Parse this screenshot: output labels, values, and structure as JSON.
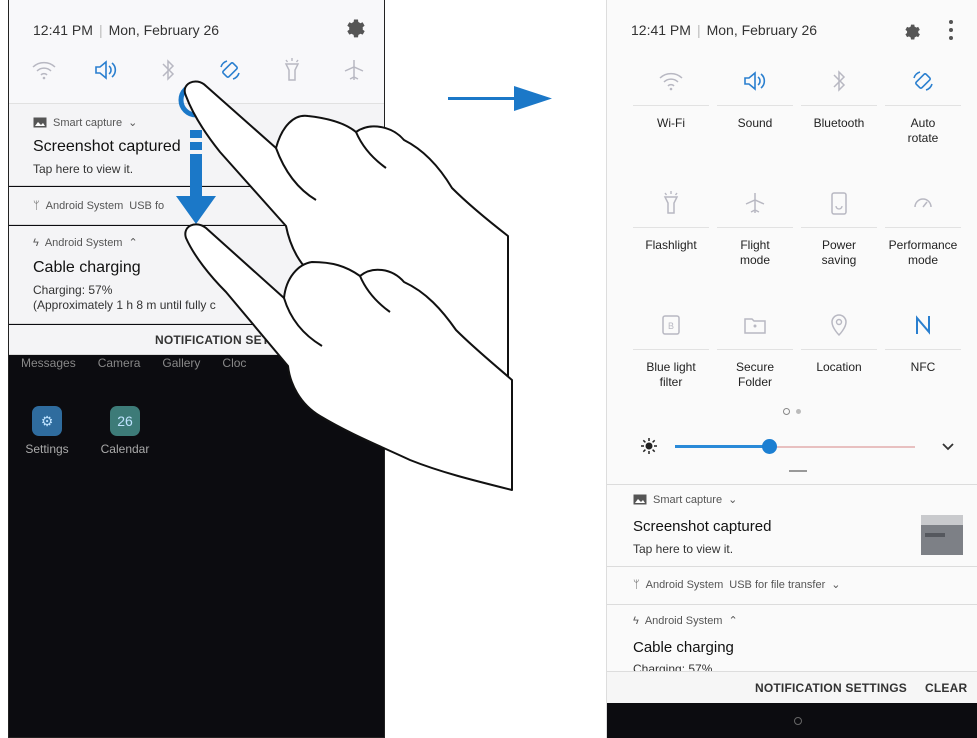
{
  "colors": {
    "accent": "#1c7fd2",
    "shade_bg": "#f8f8fa",
    "screen_dark": "#0c0c10",
    "arrow_blue": "#1b78c8"
  },
  "left_phone": {
    "status": {
      "time": "12:41 PM",
      "date": "Mon, February 26"
    },
    "quick_icons": [
      "wifi-icon",
      "sound-icon",
      "bluetooth-icon",
      "auto-rotate-icon",
      "flashlight-icon",
      "airplane-icon"
    ],
    "notifications": [
      {
        "app": "Smart capture",
        "title": "Screenshot captured",
        "text": "Tap here to view it."
      },
      {
        "app": "Android System",
        "detail": "USB fo"
      },
      {
        "app": "Android System",
        "title": "Cable charging",
        "text_line1": "Charging: 57%",
        "text_line2": "(Approximately 1 h 8 m until fully c"
      }
    ],
    "notification_settings": "NOTIFICATION SETTIN",
    "home_row": [
      "Messages",
      "Camera",
      "Gallery",
      "Cloc"
    ],
    "apps": [
      {
        "name": "Settings"
      },
      {
        "name": "Calendar",
        "icon_text": "26"
      }
    ]
  },
  "right_phone": {
    "status": {
      "time": "12:41 PM",
      "date": "Mon, February 26"
    },
    "tiles": [
      {
        "label": "Wi-Fi",
        "icon": "wifi-icon",
        "active": false
      },
      {
        "label": "Sound",
        "icon": "sound-icon",
        "active": true
      },
      {
        "label": "Bluetooth",
        "icon": "bluetooth-icon",
        "active": false
      },
      {
        "label": "Auto\nrotate",
        "icon": "auto-rotate-icon",
        "active": true
      },
      {
        "label": "Flashlight",
        "icon": "flashlight-icon",
        "active": false
      },
      {
        "label": "Flight\nmode",
        "icon": "airplane-icon",
        "active": false
      },
      {
        "label": "Power\nsaving",
        "icon": "power-saving-icon",
        "active": false
      },
      {
        "label": "Performance\nmode",
        "icon": "performance-icon",
        "active": false
      },
      {
        "label": "Blue light\nfilter",
        "icon": "blue-light-icon",
        "active": false
      },
      {
        "label": "Secure\nFolder",
        "icon": "secure-folder-icon",
        "active": false
      },
      {
        "label": "Location",
        "icon": "location-icon",
        "active": false
      },
      {
        "label": "NFC",
        "icon": "nfc-icon",
        "active": true
      }
    ],
    "brightness": {
      "level": 0.39
    },
    "notifications": [
      {
        "app": "Smart capture",
        "title": "Screenshot captured",
        "text": "Tap here to view it."
      },
      {
        "app": "Android System",
        "detail": "USB for file transfer"
      },
      {
        "app": "Android System",
        "title": "Cable charging",
        "text": "Charging: 57%"
      }
    ],
    "notification_settings": "NOTIFICATION SETTINGS",
    "clear": "CLEAR"
  }
}
